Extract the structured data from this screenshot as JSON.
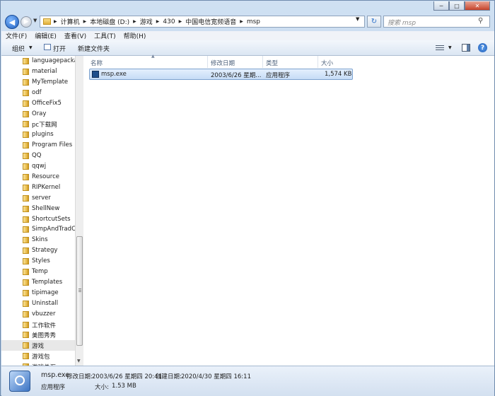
{
  "window": {
    "caption_buttons": [
      "minimize-icon",
      "maximize-icon",
      "close-icon"
    ]
  },
  "address_bar": {
    "crumbs": [
      "计算机",
      "本地磁盘 (D:)",
      "游戏",
      "430",
      "中国电信宽频语音",
      "msp"
    ],
    "search_placeholder": "搜索 msp"
  },
  "menu": [
    "文件(F)",
    "编辑(E)",
    "查看(V)",
    "工具(T)",
    "帮助(H)"
  ],
  "toolbar": {
    "organize": "组织",
    "open": "打开",
    "new_folder": "新建文件夹"
  },
  "nav_folders": [
    "languagepacka",
    "material",
    "MyTemplate",
    "odf",
    "OfficeFix5",
    "Oray",
    "pc下载网",
    "plugins",
    "Program Files",
    "QQ",
    "qqwj",
    "Resource",
    "RIPKernel",
    "server",
    "ShellNew",
    "ShortcutSets",
    "SimpAndTradCo",
    "Skins",
    "Strategy",
    "Styles",
    "Temp",
    "Templates",
    "tipimage",
    "Uninstall",
    "vbuzzer",
    "工作软件",
    "美图秀秀",
    "游戏",
    "游戏包",
    "游戏总汇"
  ],
  "nav_selected_index": 27,
  "columns": {
    "name": "名称",
    "date": "修改日期",
    "type": "类型",
    "size": "大小"
  },
  "files": [
    {
      "name": "msp.exe",
      "date": "2003/6/26 星期...",
      "type": "应用程序",
      "size": "1,574 KB"
    }
  ],
  "status": {
    "file_name": "msp.exe",
    "modified_label": "修改日期:",
    "modified_value": "2003/6/26 星期四 20:41",
    "created_label": "创建日期:",
    "created_value": "2020/4/30 星期四 16:11",
    "type": "应用程序",
    "size_label": "大小:",
    "size_value": "1.53 MB"
  },
  "colors": {
    "selection": "#c6dcf6",
    "frame": "#b7cde6",
    "folder": "#e8bb48"
  }
}
